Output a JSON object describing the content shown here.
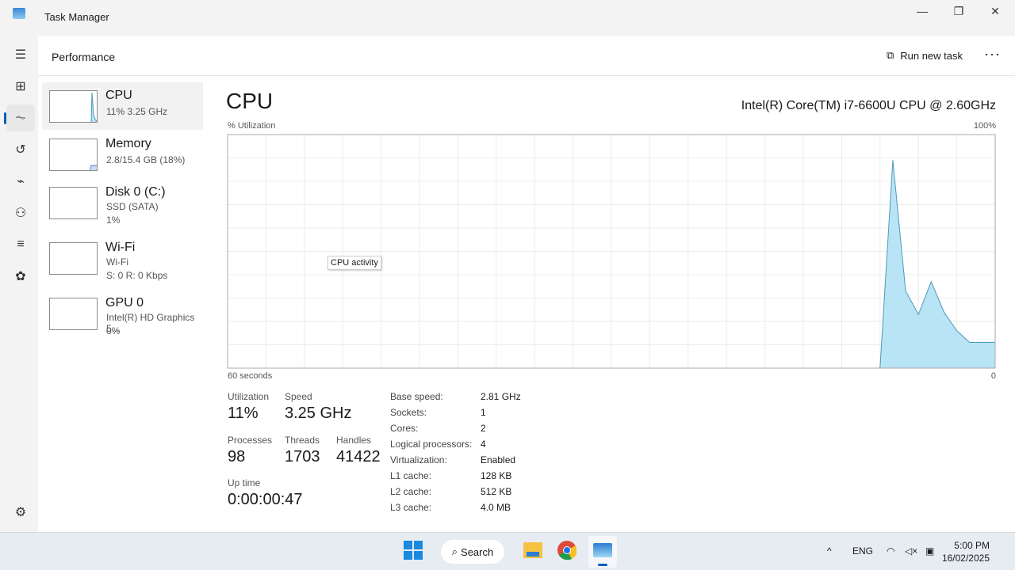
{
  "window": {
    "title": "Task Manager",
    "minimize": "—",
    "maximize": "❐",
    "close": "✕"
  },
  "header": {
    "title": "Performance",
    "run_new_task": "Run new task",
    "more": "···"
  },
  "nav": [
    "menu-icon",
    "processes-icon",
    "performance-icon",
    "app-history-icon",
    "startup-icon",
    "users-icon",
    "details-icon",
    "services-icon",
    "settings-icon"
  ],
  "sidebar": [
    {
      "name": "CPU",
      "line1": "11%  3.25 GHz",
      "line2": ""
    },
    {
      "name": "Memory",
      "line1": "2.8/15.4 GB (18%)",
      "line2": ""
    },
    {
      "name": "Disk 0 (C:)",
      "line1": "SSD (SATA)",
      "line2": "1%"
    },
    {
      "name": "Wi-Fi",
      "line1": "Wi-Fi",
      "line2": "S: 0  R: 0 Kbps"
    },
    {
      "name": "GPU 0",
      "line1": "Intel(R) HD Graphics 5...",
      "line2": "0%"
    }
  ],
  "main": {
    "title": "CPU",
    "model": "Intel(R) Core(TM) i7-6600U CPU @ 2.60GHz",
    "y_label": "% Utilization",
    "y_max_label": "100%",
    "x_left_label": "60 seconds",
    "x_right_label": "0",
    "tooltip": "CPU activity",
    "stats": [
      {
        "label": "Utilization",
        "value": "11%"
      },
      {
        "label": "Speed",
        "value": "3.25 GHz"
      },
      {
        "label": "Processes",
        "value": "98"
      },
      {
        "label": "Threads",
        "value": "1703"
      },
      {
        "label": "Handles",
        "value": "41422"
      },
      {
        "label": "Up time",
        "value": "0:00:00:47"
      }
    ],
    "details": [
      {
        "k": "Base speed:",
        "v": "2.81 GHz"
      },
      {
        "k": "Sockets:",
        "v": "1"
      },
      {
        "k": "Cores:",
        "v": "2"
      },
      {
        "k": "Logical processors:",
        "v": "4"
      },
      {
        "k": "Virtualization:",
        "v": "Enabled"
      },
      {
        "k": "L1 cache:",
        "v": "128 KB"
      },
      {
        "k": "L2 cache:",
        "v": "512 KB"
      },
      {
        "k": "L3 cache:",
        "v": "4.0 MB"
      }
    ]
  },
  "chart_data": {
    "type": "area",
    "xlabel": "60 seconds",
    "ylabel": "% Utilization",
    "xlim": [
      60,
      0
    ],
    "ylim": [
      0,
      100
    ],
    "grid": true,
    "x": [
      60,
      10,
      9,
      8,
      7,
      6,
      5,
      4,
      3,
      2,
      1,
      0
    ],
    "values": [
      0,
      0,
      0,
      89,
      33,
      23,
      37,
      24,
      16,
      11,
      11,
      11
    ],
    "color": "#b9e4f6",
    "line_color": "#4a9ab8"
  },
  "taskbar": {
    "search": "Search",
    "lang": "ENG",
    "time": "5:00 PM",
    "date": "16/02/2025"
  }
}
